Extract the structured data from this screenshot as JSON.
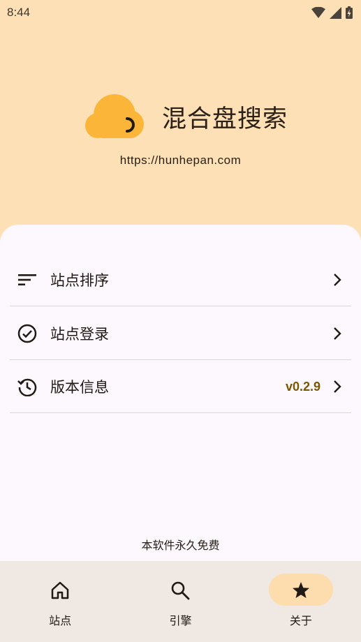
{
  "status_bar": {
    "time": "8:44"
  },
  "app": {
    "title": "混合盘搜索",
    "url": "https://hunhepan.com"
  },
  "menu": [
    {
      "label": "站点排序",
      "icon": "sort-icon",
      "value": ""
    },
    {
      "label": "站点登录",
      "icon": "check-circle-icon",
      "value": ""
    },
    {
      "label": "版本信息",
      "icon": "history-icon",
      "value": "v0.2.9"
    }
  ],
  "footer_note": "本软件永久免费",
  "nav": [
    {
      "label": "站点",
      "icon": "home-icon",
      "active": false
    },
    {
      "label": "引擎",
      "icon": "search-icon",
      "active": false
    },
    {
      "label": "关于",
      "icon": "star-icon",
      "active": true
    }
  ],
  "colors": {
    "hero_bg": "#fde0b5",
    "sheet_bg": "#fcf8fd",
    "accent": "#fbb63a",
    "version_text": "#7a5800",
    "nav_bg": "#f0e8e2",
    "nav_active": "#fddcad"
  }
}
